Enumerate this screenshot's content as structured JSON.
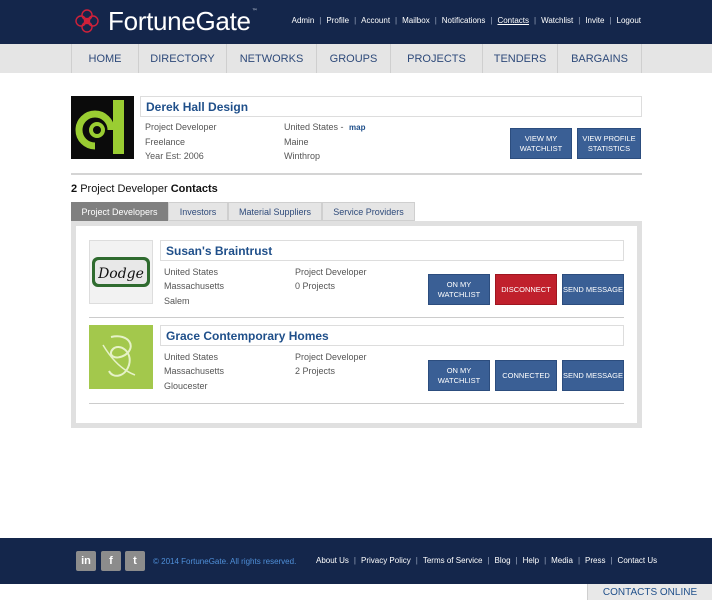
{
  "brand": {
    "name": "FortuneGate",
    "tm": "™"
  },
  "toplinks": [
    "Admin",
    "Profile",
    "Account",
    "Mailbox",
    "Notifications",
    "Contacts",
    "Watchlist",
    "Invite",
    "Logout"
  ],
  "toplinks_active": "Contacts",
  "nav": [
    "HOME",
    "DIRECTORY",
    "NETWORKS",
    "GROUPS",
    "PROJECTS",
    "TENDERS",
    "BARGAINS"
  ],
  "profile": {
    "name": "Derek Hall Design",
    "role": "Project Developer",
    "type": "Freelance",
    "year": "Year Est: 2006",
    "country": "United States -",
    "map_link": "map",
    "state": "Maine",
    "city": "Winthrop",
    "btn_watchlist": "VIEW MY WATCHLIST",
    "btn_stats": "VIEW PROFILE STATISTICS"
  },
  "contacts_heading": {
    "count": "2",
    "role": "Project Developer",
    "suffix": "Contacts"
  },
  "tabs": [
    "Project Developers",
    "Investors",
    "Material Suppliers",
    "Service Providers"
  ],
  "contacts": [
    {
      "name": "Susan's Braintrust",
      "logo_text": "Dodge",
      "country": "United States",
      "state": "Massachusetts",
      "city": "Salem",
      "role": "Project Developer",
      "projects": "0 Projects",
      "btn_watchlist": "ON MY WATCHLIST",
      "btn_connect": "DISCONNECT",
      "btn_message": "SEND MESSAGE"
    },
    {
      "name": "Grace Contemporary Homes",
      "country": "United States",
      "state": "Massachusetts",
      "city": "Gloucester",
      "role": "Project Developer",
      "projects": "2 Projects",
      "btn_watchlist": "ON MY WATCHLIST",
      "btn_connect": "CONNECTED",
      "btn_message": "SEND MESSAGE"
    }
  ],
  "footer": {
    "social": [
      "in",
      "f",
      "t"
    ],
    "copyright": "© 2014 FortuneGate. All rights reserved.",
    "links": [
      "About Us",
      "Privacy Policy",
      "Terms of Service",
      "Blog",
      "Help",
      "Media",
      "Press",
      "Contact Us"
    ]
  },
  "contacts_online": "CONTACTS ONLINE",
  "colors": {
    "header_bg": "#14264b",
    "link_blue": "#1f4f8a",
    "button_blue": "#3a5f95",
    "disconnect_red": "#c0202c",
    "logo_green": "#9acd32"
  }
}
